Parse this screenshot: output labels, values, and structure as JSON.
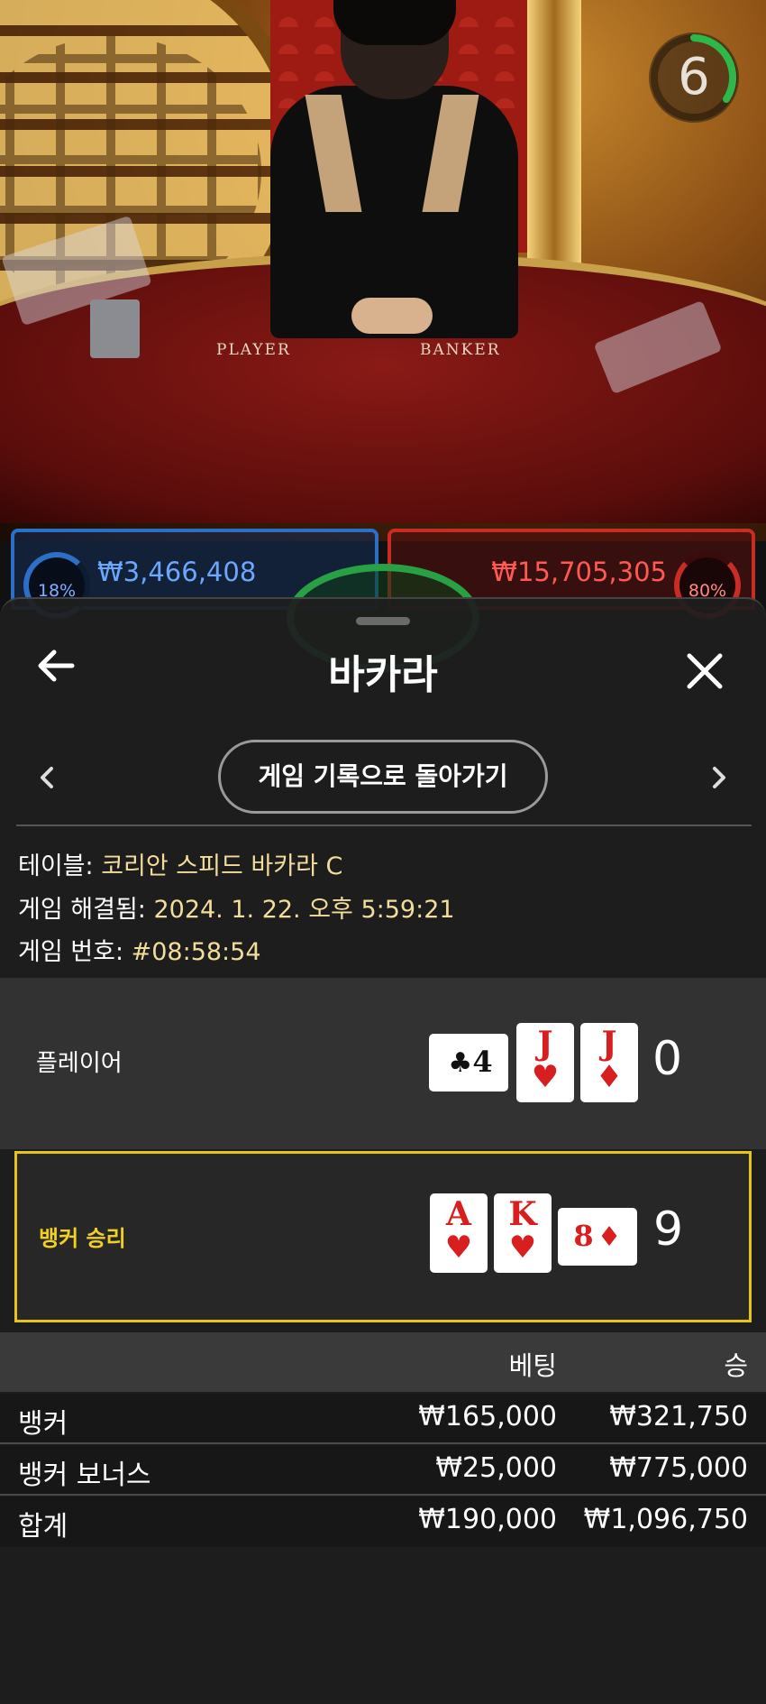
{
  "video": {
    "countdown": "6",
    "felt_player": "PLAYER",
    "felt_banker": "BANKER",
    "player_pct": "18%",
    "player_amount": "₩3,466,408",
    "banker_pct": "80%",
    "banker_amount": "₩15,705,305"
  },
  "sheet": {
    "title": "바카라",
    "history_button": "게임 기록으로 돌아가기",
    "table_label": "테이블: ",
    "table_value": "코리안 스피드 바카라 C",
    "resolved_label": "게임 해결됨: ",
    "resolved_value": "2024. 1. 22. 오후 5:59:21",
    "round_label": "게임 번호: ",
    "round_value": "#08:58:54"
  },
  "player_hand": {
    "label": "플레이어",
    "score": "0",
    "cards": [
      {
        "rank": "4",
        "suit": "♣",
        "color": "black",
        "orientation": "side"
      },
      {
        "rank": "J",
        "suit": "♥",
        "color": "red",
        "orientation": "upright"
      },
      {
        "rank": "J",
        "suit": "♦",
        "color": "red",
        "orientation": "upright"
      }
    ]
  },
  "banker_hand": {
    "label": "뱅커 승리",
    "score": "9",
    "cards": [
      {
        "rank": "A",
        "suit": "♥",
        "color": "red",
        "orientation": "upright"
      },
      {
        "rank": "K",
        "suit": "♥",
        "color": "red",
        "orientation": "upright"
      },
      {
        "rank": "8",
        "suit": "♦",
        "color": "red",
        "orientation": "side"
      }
    ]
  },
  "bets": {
    "headers": {
      "bet": "베팅",
      "win": "승"
    },
    "rows": [
      {
        "name": "뱅커",
        "bet": "₩165,000",
        "win": "₩321,750"
      },
      {
        "name": "뱅커 보너스",
        "bet": "₩25,000",
        "win": "₩775,000"
      }
    ],
    "total": {
      "name": "합계",
      "bet": "₩190,000",
      "win": "₩1,096,750"
    }
  },
  "colors": {
    "accent_gold": "#f2cf23",
    "player_blue": "#2c6fc7",
    "banker_red": "#c92b25",
    "timer_green": "#2fb84a"
  }
}
